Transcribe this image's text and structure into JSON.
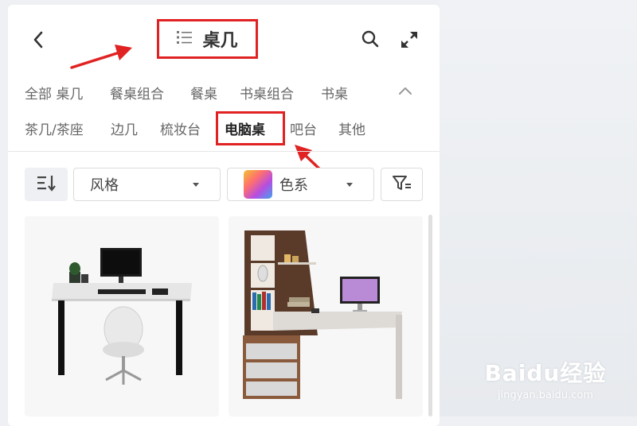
{
  "header": {
    "title": "桌几",
    "back_icon": "chevron-left-icon",
    "list_icon": "list-icon",
    "search_icon": "search-icon",
    "expand_icon": "expand-icon"
  },
  "categories": {
    "row1": [
      "全部 桌几",
      "餐桌组合",
      "餐桌",
      "书桌组合",
      "书桌"
    ],
    "row2": [
      "茶几/茶座",
      "边几",
      "梳妆台",
      "电脑桌",
      "吧台",
      "其他"
    ],
    "active": "电脑桌",
    "collapse_icon": "chevron-up-icon"
  },
  "filters": {
    "sort_icon": "sort-icon",
    "style_label": "风格",
    "color_label": "色系",
    "filter_icon": "filter-icon"
  },
  "products": [
    {
      "image": "computer-desk-white-top-black-legs"
    },
    {
      "image": "computer-desk-with-bookshelf"
    }
  ],
  "watermark": {
    "main": "Baidu经验",
    "sub": "jingyan.baidu.com"
  },
  "colors": {
    "highlight": "#e02222",
    "background": "#eef0f3"
  }
}
